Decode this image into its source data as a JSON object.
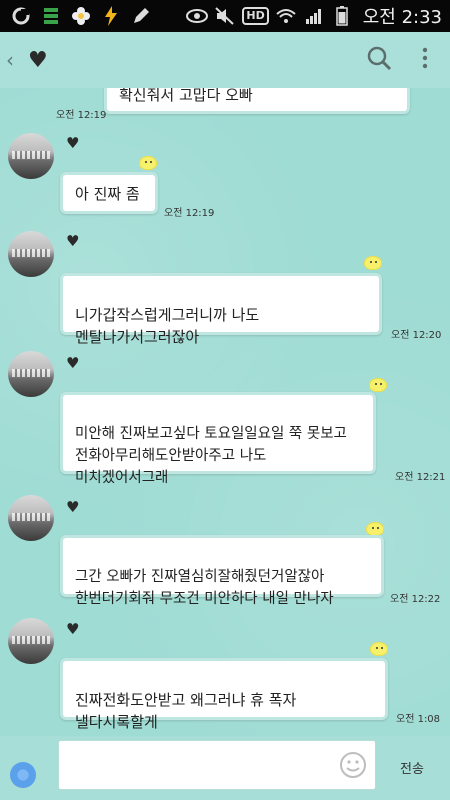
{
  "status_bar": {
    "hd": "HD",
    "time": "오전 2:33",
    "icons": [
      "carrier-icon",
      "storage-icon",
      "flower-icon",
      "bolt-icon",
      "pencil-icon",
      "eye-icon",
      "mute-icon",
      "hd-icon",
      "wifi-icon",
      "signal-icon",
      "battery-icon"
    ]
  },
  "header": {
    "back_icon": "chevron-left-icon",
    "contact_icon": "heart-icon",
    "search_icon": "search-icon",
    "menu_icon": "more-vert-icon"
  },
  "messages": [
    {
      "text": "확신줘서 고맙다 오빠",
      "time": "오전 12:19"
    },
    {
      "text": "아 진짜 좀",
      "time": "오전 12:19"
    },
    {
      "text": "니가갑작스럽게그러니까 나도\n멘탈나가서그러잖아",
      "time": "오전 12:20"
    },
    {
      "text": "미안해 진짜보고싶다 토요일일요일 쭉 못보고\n전화아무리해도안받아주고 나도\n미치겠어서그래",
      "time": "오전 12:21"
    },
    {
      "text": "그간 오빠가 진짜열심히잘해줬던거알잖아\n한번더기회줘 무조건 미안하다  내일 만나자",
      "time": "오전 12:22"
    },
    {
      "text": "진짜전화도안받고 왜그러냐  휴 폭자\n낼다시록할게",
      "time": "오전 1:08"
    }
  ],
  "input": {
    "placeholder": "",
    "send_label": "전송",
    "emoji_icon": "smiley-icon"
  }
}
